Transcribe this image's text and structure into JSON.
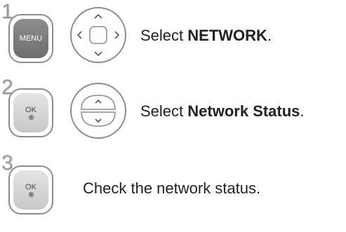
{
  "steps": [
    {
      "number": "1",
      "button_label": "MENU",
      "instruction_prefix": "Select ",
      "instruction_bold": "NETWORK",
      "instruction_suffix": "."
    },
    {
      "number": "2",
      "button_label": "OK",
      "instruction_prefix": "Select ",
      "instruction_bold": "Network Status",
      "instruction_suffix": "."
    },
    {
      "number": "3",
      "button_label": "OK",
      "instruction_prefix": "Check the network status.",
      "instruction_bold": "",
      "instruction_suffix": ""
    }
  ],
  "icons": {
    "navigation": "four-way-navigation-pad-icon",
    "updown": "up-down-arrow-buttons-icon"
  },
  "colors": {
    "button_gray": "#7d7d7d",
    "ok_gray": "#d6d6d6",
    "outline": "#8c8c8c",
    "step_number": "#9a9a9a"
  }
}
